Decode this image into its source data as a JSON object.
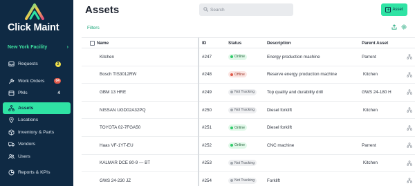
{
  "sidebar": {
    "logo_text": "Click Maint",
    "facility": "New York Facility",
    "facility_chevron": "›",
    "items": [
      {
        "label": "Requests",
        "icon": "inbox-icon",
        "badge": "2",
        "badge_style": "yellow"
      },
      {
        "label": "Work Orders",
        "icon": "wrench-icon",
        "badge": "04",
        "badge_style": "red"
      },
      {
        "label": "PMs",
        "icon": "calendar-icon",
        "badge": "4",
        "badge_style": "plain"
      },
      {
        "label": "Assets",
        "icon": "sitemap-icon",
        "badge": "",
        "active": true
      },
      {
        "label": "Locations",
        "icon": "location-pin-icon",
        "badge": ""
      },
      {
        "label": "Inventory & Parts",
        "icon": "box-icon",
        "badge": ""
      },
      {
        "label": "Vendors",
        "icon": "truck-icon",
        "badge": ""
      },
      {
        "label": "Users",
        "icon": "users-icon",
        "badge": ""
      },
      {
        "label": "Reports & KPIs",
        "icon": "chart-icon",
        "badge": ""
      }
    ]
  },
  "header": {
    "title": "Assets",
    "search_placeholder": "Search",
    "add_button_label": "Asset",
    "filters_label": "Filters"
  },
  "table": {
    "columns": {
      "name": "Name",
      "id": "ID",
      "status": "Status",
      "description": "Description",
      "parent": "Parent Asset"
    },
    "rows": [
      {
        "name": "Kitchen",
        "id": "#247",
        "status": "Online",
        "status_type": "online",
        "description": "Energy production machine",
        "parent": "Parrent"
      },
      {
        "name": "Bosch TIS3012RW",
        "id": "#248",
        "status": "Offline",
        "status_type": "offline",
        "description": "Reserve energy production machine",
        "parent": "Kitchen"
      },
      {
        "name": "GBM 13 HRE",
        "id": "#249",
        "status": "Not Tracking",
        "status_type": "nottracking",
        "description": "Top quality and durability drill",
        "parent": "GWS 24-180 H"
      },
      {
        "name": "NISSAN UGD02A32PQ",
        "id": "#250",
        "status": "Not Tracking",
        "status_type": "nottracking",
        "description": "Diesel forklift",
        "parent": "Kitchen"
      },
      {
        "name": "TOYOTA 02-7FGA50",
        "id": "#251",
        "status": "Online",
        "status_type": "online",
        "description": "Diesel forklift",
        "parent": ""
      },
      {
        "name": "Haas VF-1YT-EU",
        "id": "#252",
        "status": "Online",
        "status_type": "online",
        "description": "CNC machine",
        "parent": "Parrent"
      },
      {
        "name": "KALMAR DCE 80-9 — BT",
        "id": "#253",
        "status": "Not Tracking",
        "status_type": "nottracking",
        "description": "",
        "parent": "Kitchen"
      },
      {
        "name": "GWS 24-230 JZ",
        "id": "#254",
        "status": "Not Tracking",
        "status_type": "nottracking",
        "description": "Forklift",
        "parent": ""
      }
    ]
  },
  "colors": {
    "sidebar_bg": "#0f2a44",
    "accent": "#2fe3a4",
    "accent_text": "#1aa679"
  }
}
